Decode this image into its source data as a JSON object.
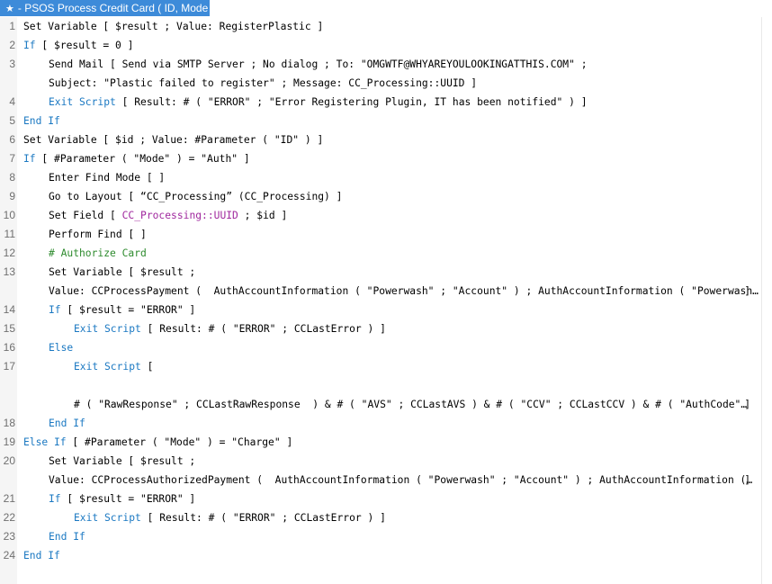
{
  "window": {
    "tab_star": "★",
    "tab_title": "- PSOS Process Credit Card ( ID, Mode )"
  },
  "script_lines": [
    {
      "n": "1",
      "indent": 0,
      "parts": [
        {
          "t": "Set Variable [ $result ; Value: RegisterPlastic ]",
          "c": ""
        }
      ]
    },
    {
      "n": "2",
      "indent": 0,
      "parts": [
        {
          "t": "If",
          "c": "kw"
        },
        {
          "t": " [ $result = 0 ]",
          "c": ""
        }
      ]
    },
    {
      "n": "3",
      "indent": 1,
      "parts": [
        {
          "t": "Send Mail [ Send via SMTP Server ; No dialog ; To: \"OMGWTF@WHYAREYOULOOKINGATTHIS.COM\" ;",
          "c": ""
        }
      ]
    },
    {
      "n": "",
      "indent": 1,
      "parts": [
        {
          "t": "Subject: \"Plastic failed to register\" ; Message: CC_Processing::UUID ]",
          "c": ""
        }
      ]
    },
    {
      "n": "4",
      "indent": 1,
      "parts": [
        {
          "t": "Exit Script",
          "c": "kw"
        },
        {
          "t": " [ Result: # ( \"ERROR\" ; \"Error Registering Plugin, IT has been notified\" ) ]",
          "c": ""
        }
      ]
    },
    {
      "n": "5",
      "indent": 0,
      "parts": [
        {
          "t": "End If",
          "c": "kw"
        }
      ]
    },
    {
      "n": "6",
      "indent": 0,
      "parts": [
        {
          "t": "Set Variable [ $id ; Value: #Parameter ( \"ID\" ) ]",
          "c": ""
        }
      ]
    },
    {
      "n": "7",
      "indent": 0,
      "parts": [
        {
          "t": "If",
          "c": "kw"
        },
        {
          "t": " [ #Parameter ( \"Mode\" ) = \"Auth\" ]",
          "c": ""
        }
      ]
    },
    {
      "n": "8",
      "indent": 1,
      "parts": [
        {
          "t": "Enter Find Mode [ ]",
          "c": ""
        }
      ]
    },
    {
      "n": "9",
      "indent": 1,
      "parts": [
        {
          "t": "Go to Layout [ “CC_Processing” (CC_Processing) ]",
          "c": ""
        }
      ]
    },
    {
      "n": "10",
      "indent": 1,
      "parts": [
        {
          "t": "Set Field [ ",
          "c": ""
        },
        {
          "t": "CC_Processing::UUID",
          "c": "fld"
        },
        {
          "t": " ; $id ]",
          "c": ""
        }
      ]
    },
    {
      "n": "11",
      "indent": 1,
      "parts": [
        {
          "t": "Perform Find [ ]",
          "c": ""
        }
      ]
    },
    {
      "n": "12",
      "indent": 1,
      "parts": [
        {
          "t": "# Authorize Card",
          "c": "cm"
        }
      ]
    },
    {
      "n": "13",
      "indent": 1,
      "parts": [
        {
          "t": "Set Variable [ $result ;",
          "c": ""
        }
      ]
    },
    {
      "n": "",
      "indent": 1,
      "parts": [
        {
          "t": "Value: CCProcessPayment (  AuthAccountInformation ( \"Powerwash\" ; \"Account\" ) ; AuthAccountInformation ( \"Powerwash…",
          "c": ""
        }
      ],
      "trail": "]"
    },
    {
      "n": "14",
      "indent": 1,
      "parts": [
        {
          "t": "If",
          "c": "kw"
        },
        {
          "t": " [ $result = \"ERROR\" ]",
          "c": ""
        }
      ]
    },
    {
      "n": "15",
      "indent": 2,
      "parts": [
        {
          "t": "Exit Script",
          "c": "kw"
        },
        {
          "t": " [ Result: # ( \"ERROR\" ; CCLastError ) ]",
          "c": ""
        }
      ]
    },
    {
      "n": "16",
      "indent": 1,
      "parts": [
        {
          "t": "Else",
          "c": "kw"
        }
      ]
    },
    {
      "n": "17",
      "indent": 2,
      "parts": [
        {
          "t": "Exit Script",
          "c": "kw"
        },
        {
          "t": " [",
          "c": ""
        }
      ]
    },
    {
      "n": "",
      "indent": 2,
      "parts": []
    },
    {
      "n": "",
      "indent": 2,
      "parts": [
        {
          "t": "# ( \"RawResponse\" ; CCLastRawResponse  ) & # ( \"AVS\" ; CCLastAVS ) & # ( \"CCV\" ; CCLastCCV ) & # ( \"AuthCode\"…",
          "c": ""
        }
      ],
      "trail": "]"
    },
    {
      "n": "18",
      "indent": 1,
      "parts": [
        {
          "t": "End If",
          "c": "kw"
        }
      ]
    },
    {
      "n": "19",
      "indent": 0,
      "parts": [
        {
          "t": "Else If",
          "c": "kw"
        },
        {
          "t": " [ #Parameter ( \"Mode\" ) = \"Charge\" ]",
          "c": ""
        }
      ]
    },
    {
      "n": "20",
      "indent": 1,
      "parts": [
        {
          "t": "Set Variable [ $result ;",
          "c": ""
        }
      ]
    },
    {
      "n": "",
      "indent": 1,
      "parts": [
        {
          "t": "Value: CCProcessAuthorizedPayment (  AuthAccountInformation ( \"Powerwash\" ; \"Account\" ) ; AuthAccountInformation (…",
          "c": ""
        }
      ],
      "trail": "]"
    },
    {
      "n": "21",
      "indent": 1,
      "parts": [
        {
          "t": "If",
          "c": "kw"
        },
        {
          "t": " [ $result = \"ERROR\" ]",
          "c": ""
        }
      ]
    },
    {
      "n": "22",
      "indent": 2,
      "parts": [
        {
          "t": "Exit Script",
          "c": "kw"
        },
        {
          "t": " [ Result: # ( \"ERROR\" ; CCLastError ) ]",
          "c": ""
        }
      ]
    },
    {
      "n": "23",
      "indent": 1,
      "parts": [
        {
          "t": "End If",
          "c": "kw"
        }
      ]
    },
    {
      "n": "24",
      "indent": 0,
      "parts": [
        {
          "t": "End If",
          "c": "kw"
        }
      ]
    }
  ]
}
